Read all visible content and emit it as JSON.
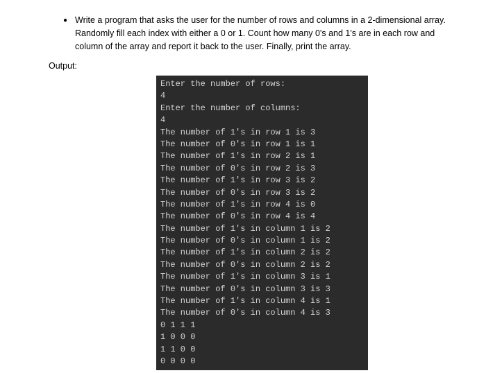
{
  "problem": {
    "bullet": "●",
    "text": "Write a program that asks the user for the number of rows and columns in a 2-dimensional array. Randomly fill each index with either a 0 or 1. Count how many 0's and 1's are in each row and column of the array and report it back to the user. Finally, print the array."
  },
  "output_label": "Output:",
  "terminal": {
    "lines": [
      "Enter the number of rows:",
      "4",
      "Enter the number of columns:",
      "4",
      "The number of 1's in row 1 is 3",
      "The number of 0's in row 1 is 1",
      "The number of 1's in row 2 is 1",
      "The number of 0's in row 2 is 3",
      "The number of 1's in row 3 is 2",
      "The number of 0's in row 3 is 2",
      "The number of 1's in row 4 is 0",
      "The number of 0's in row 4 is 4",
      "The number of 1's in column 1 is 2",
      "The number of 0's in column 1 is 2",
      "The number of 1's in column 2 is 2",
      "The number of 0's in column 2 is 2",
      "The number of 1's in column 3 is 1",
      "The number of 0's in column 3 is 3",
      "The number of 1's in column 4 is 1",
      "The number of 0's in column 4 is 3",
      "0 1 1 1",
      "1 0 0 0",
      "1 1 0 0",
      "0 0 0 0"
    ]
  }
}
